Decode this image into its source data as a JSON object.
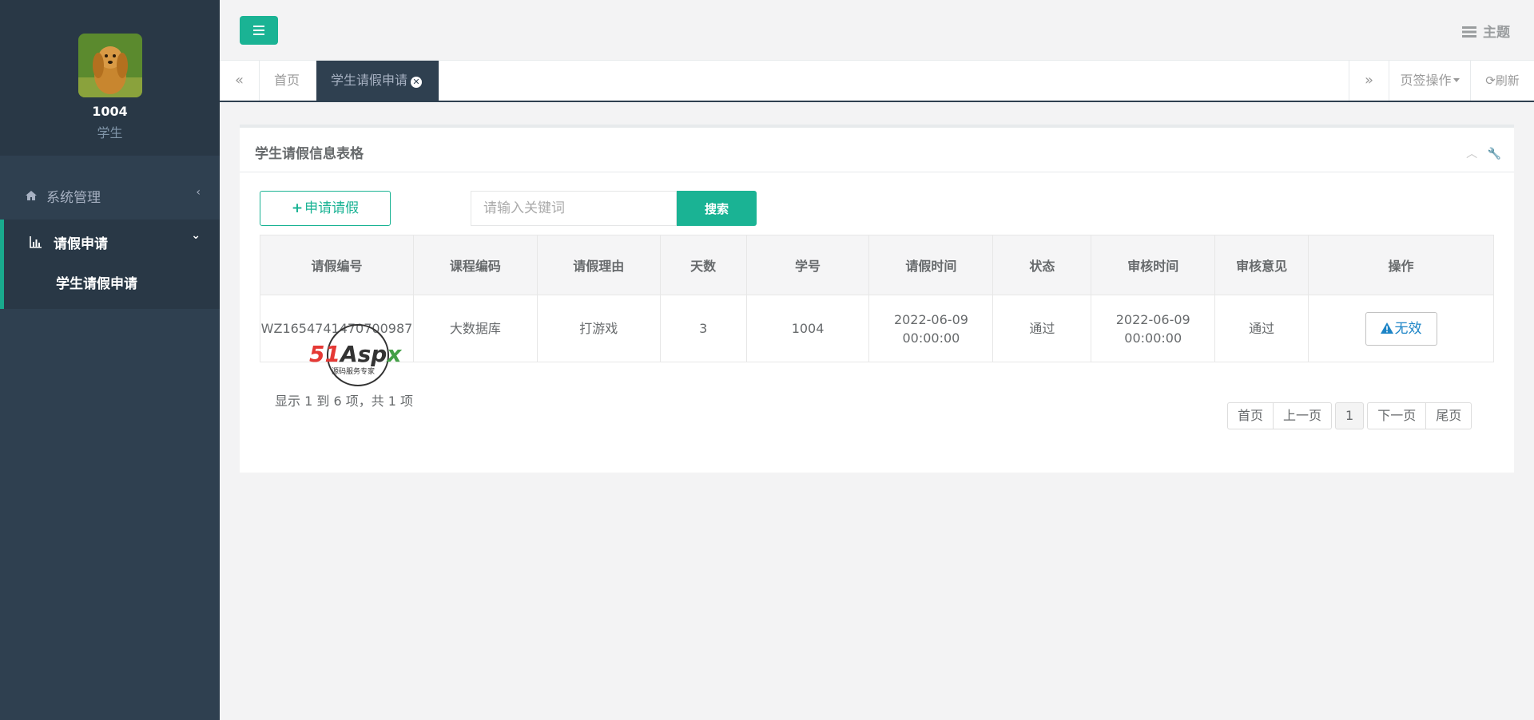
{
  "profile": {
    "name": "1004",
    "role": "学生"
  },
  "sidebar": {
    "items": [
      {
        "label": "系统管理",
        "icon": "home-icon",
        "chevron": "‹"
      },
      {
        "label": "请假申请",
        "icon": "bar-chart-icon",
        "chevron": "⌄"
      }
    ],
    "sub_items": [
      {
        "label": "学生请假申请"
      }
    ]
  },
  "topbar": {
    "theme_label": "主题"
  },
  "tabs": {
    "home": "首页",
    "active": "学生请假申请",
    "ops_label": "页签操作",
    "refresh_label": "刷新"
  },
  "panel": {
    "title": "学生请假信息表格",
    "apply_label": "申请请假",
    "search_placeholder": "请输入关键词",
    "search_label": "搜索"
  },
  "table": {
    "headers": [
      "请假编号",
      "课程编码",
      "请假理由",
      "天数",
      "学号",
      "请假时间",
      "状态",
      "审核时间",
      "审核意见",
      "操作"
    ],
    "rows": [
      {
        "id": "WZ1654741470700987",
        "course": "大数据库",
        "reason": "打游戏",
        "days": "3",
        "student": "1004",
        "leave_date": "2022-06-09",
        "leave_time": "00:00:00",
        "status": "通过",
        "review_date": "2022-06-09",
        "review_time": "00:00:00",
        "opinion": "通过",
        "action": "无效"
      }
    ]
  },
  "pagination": {
    "info": "显示 1 到 6 项，共 1 项",
    "first": "首页",
    "prev": "上一页",
    "current": "1",
    "next": "下一页",
    "last": "尾页"
  },
  "watermark": {
    "brand": "51Aspx",
    "tagline": "源码服务专家"
  },
  "colors": {
    "accent": "#1ab394",
    "sidebar": "#2f4050",
    "link": "#1c84c6"
  }
}
